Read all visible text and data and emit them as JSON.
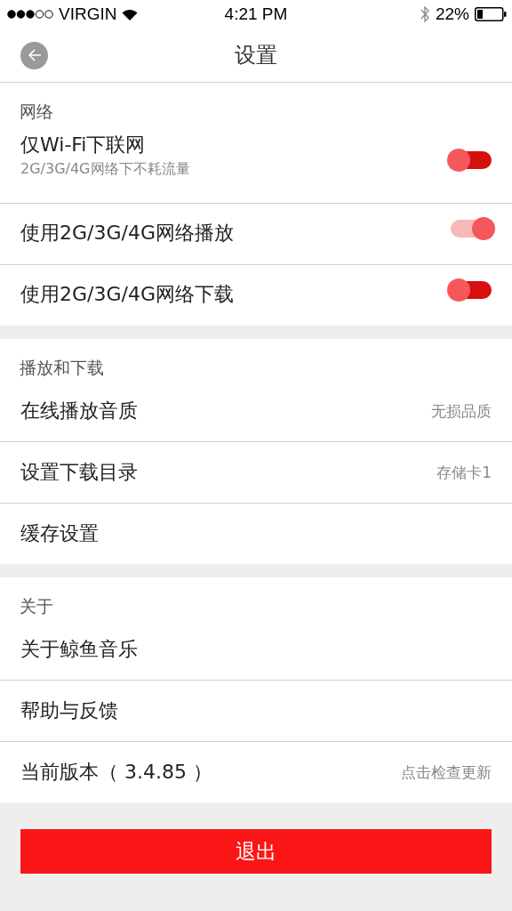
{
  "status_bar": {
    "carrier": "VIRGIN",
    "time": "4:21 PM",
    "battery": "22%"
  },
  "nav": {
    "title": "设置"
  },
  "sections": [
    {
      "title": "网络",
      "items": [
        {
          "kind": "toggle",
          "label": "仅Wi-Fi下联网",
          "subtitle": "2G/3G/4G网络下不耗流量",
          "on": false
        },
        {
          "kind": "toggle",
          "label": "使用2G/3G/4G网络播放",
          "on": true
        },
        {
          "kind": "toggle",
          "label": "使用2G/3G/4G网络下载",
          "on": false
        }
      ]
    },
    {
      "title": "播放和下载",
      "items": [
        {
          "kind": "link",
          "label": "在线播放音质",
          "value": "无损品质"
        },
        {
          "kind": "link",
          "label": "设置下载目录",
          "value": "存储卡1"
        },
        {
          "kind": "link",
          "label": "缓存设置"
        }
      ]
    },
    {
      "title": "关于",
      "items": [
        {
          "kind": "link",
          "label": "关于鲸鱼音乐"
        },
        {
          "kind": "link",
          "label": "帮助与反馈"
        },
        {
          "kind": "link",
          "label": "当前版本（ 3.4.85 ）",
          "value": "点击检查更新"
        }
      ]
    }
  ],
  "logout_button": "退出"
}
